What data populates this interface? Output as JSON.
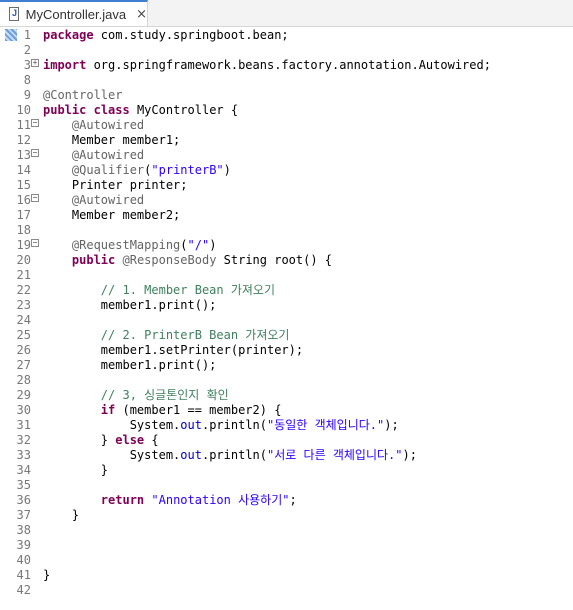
{
  "tab": {
    "title": "MyController.java",
    "close": "×"
  },
  "lines": [
    {
      "n": "1",
      "fold": "",
      "code": [
        [
          "kw",
          "package"
        ],
        [
          "t",
          " com.study.springboot.bean;"
        ]
      ]
    },
    {
      "n": "2",
      "fold": "",
      "code": []
    },
    {
      "n": "3",
      "fold": "plus",
      "code": [
        [
          "kw",
          "import"
        ],
        [
          "t",
          " org.springframework.beans.factory.annotation.Autowired;"
        ]
      ]
    },
    {
      "n": "8",
      "fold": "",
      "code": []
    },
    {
      "n": "9",
      "fold": "",
      "code": [
        [
          "ann",
          "@Controller"
        ]
      ]
    },
    {
      "n": "10",
      "fold": "",
      "code": [
        [
          "kw",
          "public"
        ],
        [
          "t",
          " "
        ],
        [
          "kw",
          "class"
        ],
        [
          "t",
          " MyController {"
        ]
      ]
    },
    {
      "n": "11",
      "fold": "minus",
      "code": [
        [
          "t",
          "    "
        ],
        [
          "ann",
          "@Autowired"
        ]
      ]
    },
    {
      "n": "12",
      "fold": "",
      "code": [
        [
          "t",
          "    Member member1;"
        ]
      ]
    },
    {
      "n": "13",
      "fold": "minus",
      "code": [
        [
          "t",
          "    "
        ],
        [
          "ann",
          "@Autowired"
        ]
      ]
    },
    {
      "n": "14",
      "fold": "",
      "code": [
        [
          "t",
          "    "
        ],
        [
          "ann",
          "@Qualifier"
        ],
        [
          "t",
          "("
        ],
        [
          "str",
          "\"printerB\""
        ],
        [
          "t",
          ")"
        ]
      ]
    },
    {
      "n": "15",
      "fold": "",
      "code": [
        [
          "t",
          "    Printer printer;"
        ]
      ]
    },
    {
      "n": "16",
      "fold": "minus",
      "code": [
        [
          "t",
          "    "
        ],
        [
          "ann",
          "@Autowired"
        ]
      ]
    },
    {
      "n": "17",
      "fold": "",
      "code": [
        [
          "t",
          "    Member member2;"
        ]
      ]
    },
    {
      "n": "18",
      "fold": "",
      "code": []
    },
    {
      "n": "19",
      "fold": "minus",
      "code": [
        [
          "t",
          "    "
        ],
        [
          "ann",
          "@RequestMapping"
        ],
        [
          "t",
          "("
        ],
        [
          "str",
          "\"/\""
        ],
        [
          "t",
          ")"
        ]
      ]
    },
    {
      "n": "20",
      "fold": "",
      "code": [
        [
          "t",
          "    "
        ],
        [
          "kw",
          "public"
        ],
        [
          "t",
          " "
        ],
        [
          "ann",
          "@ResponseBody"
        ],
        [
          "t",
          " String root() {"
        ]
      ]
    },
    {
      "n": "21",
      "fold": "",
      "code": []
    },
    {
      "n": "22",
      "fold": "",
      "code": [
        [
          "t",
          "        "
        ],
        [
          "cmt",
          "// 1. Member Bean 가져오기"
        ]
      ]
    },
    {
      "n": "23",
      "fold": "",
      "code": [
        [
          "t",
          "        member1.print();"
        ]
      ]
    },
    {
      "n": "24",
      "fold": "",
      "code": []
    },
    {
      "n": "25",
      "fold": "",
      "code": [
        [
          "t",
          "        "
        ],
        [
          "cmt",
          "// 2. PrinterB Bean 가져오기"
        ]
      ]
    },
    {
      "n": "26",
      "fold": "",
      "code": [
        [
          "t",
          "        member1.setPrinter(printer);"
        ]
      ]
    },
    {
      "n": "27",
      "fold": "",
      "code": [
        [
          "t",
          "        member1.print();"
        ]
      ]
    },
    {
      "n": "28",
      "fold": "",
      "code": []
    },
    {
      "n": "29",
      "fold": "",
      "code": [
        [
          "t",
          "        "
        ],
        [
          "cmt",
          "// 3, 싱글톤인지 확인"
        ]
      ]
    },
    {
      "n": "30",
      "fold": "",
      "code": [
        [
          "t",
          "        "
        ],
        [
          "kw",
          "if"
        ],
        [
          "t",
          " (member1 == member2) {"
        ]
      ]
    },
    {
      "n": "31",
      "fold": "",
      "code": [
        [
          "t",
          "            System."
        ],
        [
          "fld",
          "out"
        ],
        [
          "t",
          ".println("
        ],
        [
          "str",
          "\"동일한 객체입니다.\""
        ],
        [
          "t",
          ");"
        ]
      ]
    },
    {
      "n": "32",
      "fold": "",
      "code": [
        [
          "t",
          "        } "
        ],
        [
          "kw",
          "else"
        ],
        [
          "t",
          " {"
        ]
      ]
    },
    {
      "n": "33",
      "fold": "",
      "code": [
        [
          "t",
          "            System."
        ],
        [
          "fld",
          "out"
        ],
        [
          "t",
          ".println("
        ],
        [
          "str",
          "\"서로 다른 객체입니다.\""
        ],
        [
          "t",
          ");"
        ]
      ]
    },
    {
      "n": "34",
      "fold": "",
      "code": [
        [
          "t",
          "        }"
        ]
      ]
    },
    {
      "n": "35",
      "fold": "",
      "code": []
    },
    {
      "n": "36",
      "fold": "",
      "code": [
        [
          "t",
          "        "
        ],
        [
          "kw",
          "return"
        ],
        [
          "t",
          " "
        ],
        [
          "str",
          "\"Annotation 사용하기\""
        ],
        [
          "t",
          ";"
        ]
      ]
    },
    {
      "n": "37",
      "fold": "",
      "code": [
        [
          "t",
          "    }"
        ]
      ]
    },
    {
      "n": "38",
      "fold": "",
      "code": []
    },
    {
      "n": "39",
      "fold": "",
      "code": []
    },
    {
      "n": "40",
      "fold": "",
      "code": []
    },
    {
      "n": "41",
      "fold": "",
      "code": [
        [
          "t",
          "}"
        ]
      ]
    },
    {
      "n": "42",
      "fold": "",
      "code": []
    }
  ]
}
